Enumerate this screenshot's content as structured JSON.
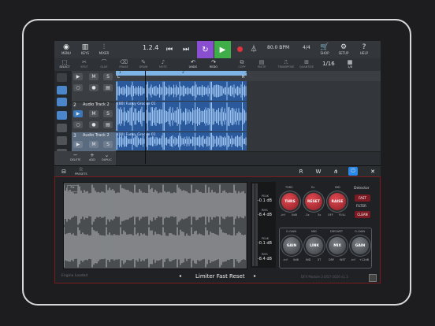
{
  "topbar": {
    "buttons": [
      {
        "label": "MENU",
        "icon": "menu-icon"
      },
      {
        "label": "KEYS",
        "icon": "keyboard-icon"
      },
      {
        "label": "MIXER",
        "icon": "mixer-icon"
      }
    ],
    "position": "1.2.4",
    "bpm": "80.0 BPM",
    "time_signature": "4/4",
    "right_buttons": [
      {
        "label": "SHOP",
        "icon": "cart-icon"
      },
      {
        "label": "SETUP",
        "icon": "gear-icon"
      },
      {
        "label": "HELP",
        "icon": "help-icon"
      }
    ],
    "loop_color": "#8a4fd0",
    "play_color": "#3fae48",
    "record_color": "#e0333b"
  },
  "toolbar": {
    "items": [
      "SELECT",
      "SPLIT",
      "GLUE",
      "ERASE",
      "DRAW",
      "NOTE",
      "UNDO",
      "REDO",
      "COPY",
      "PASTE",
      "TRANSPOSE",
      "QUANTIZE"
    ],
    "active": "SELECT",
    "page": "1/16",
    "grid_label": "1/8"
  },
  "tracks": [
    {
      "number": "",
      "name": "",
      "clip": "",
      "selected": false
    },
    {
      "number": "2",
      "name": "Audio Track 2",
      "clip": "(80) Funky Groove 01",
      "selected": false
    },
    {
      "number": "3",
      "name": "Audio Track 2",
      "clip": "(80) Funky Groove 01",
      "selected": true
    }
  ],
  "ruler": {
    "markers": [
      "1",
      "2",
      "3"
    ],
    "loop_start": "L",
    "loop_end": "R"
  },
  "track_controls": {
    "delete": "DELETE",
    "add": "ADD",
    "duplicate": "DUPLIC"
  },
  "plugin_tabs": {
    "presets": "PRESETS"
  },
  "plugin": {
    "meter_labels": [
      "PEAK",
      "RMS",
      "PEAK",
      "RMS"
    ],
    "meter_values": [
      "-0.1 dB",
      "-8.4 dB",
      "-0.1 dB",
      "-8.4 dB"
    ],
    "knobs_top": [
      {
        "name": "THRS",
        "label": "THRS",
        "range": [
          "-inf",
          "0dB"
        ]
      },
      {
        "name": "RESET",
        "label": "RESET",
        "range": [
          "-3x",
          "3x"
        ]
      },
      {
        "name": "RAISE",
        "label": "RAISE",
        "range": [
          "OFF",
          "FULL"
        ]
      }
    ],
    "knobs_top_titles": [
      "THRS",
      "Ex",
      "MID"
    ],
    "knobs_bottom": [
      {
        "name": "GAIN",
        "label": "GAIN",
        "range": [
          "-inf",
          "0dB"
        ]
      },
      {
        "name": "LINK",
        "label": "LINK",
        "range": [
          "IND",
          "ST"
        ]
      },
      {
        "name": "MIX",
        "label": "MIX",
        "range": [
          "DRY",
          "WET"
        ]
      },
      {
        "name": "GAIN2",
        "label": "GAIN",
        "range": [
          "-inf",
          "+12dB"
        ]
      }
    ],
    "knobs_bottom_titles": [
      "O-GAIN",
      "MID",
      "DRY/WET",
      "O-GAIN"
    ],
    "detector": {
      "title": "Detector",
      "fast": "FAST",
      "filter": "FILTER",
      "clean": "CLEAN"
    },
    "status": "Engine Loaded",
    "preset_name": "Limiter Fast Reset",
    "version": "DFX Module 2.0/57-2020 v1.3",
    "accent": "#7b1a1f"
  }
}
